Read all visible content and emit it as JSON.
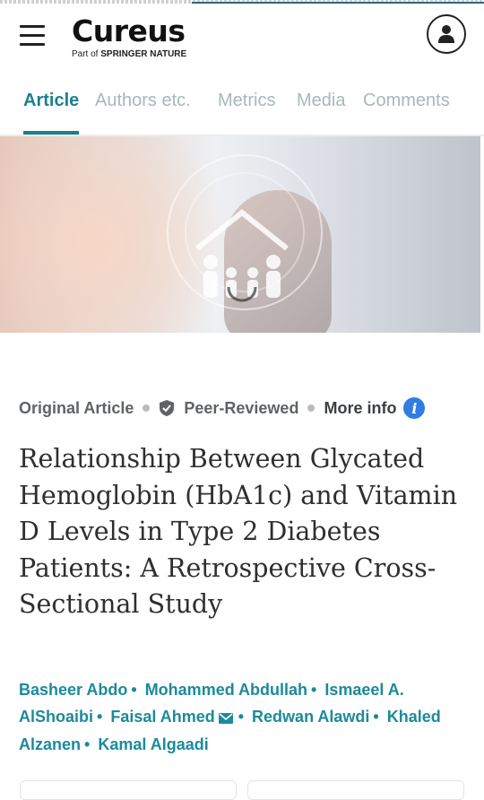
{
  "brand": {
    "logo_text": "Cureus",
    "sub_prefix": "Part of ",
    "sub_brand": "SPRINGER NATURE"
  },
  "tabs": [
    {
      "label": "Article",
      "active": true
    },
    {
      "label": "Authors etc.",
      "active": false
    },
    {
      "label": "Metrics",
      "active": false
    },
    {
      "label": "Media",
      "active": false
    },
    {
      "label": "Comments",
      "active": false
    }
  ],
  "meta": {
    "type": "Original Article",
    "peer": "Peer-Reviewed",
    "more": "More info"
  },
  "title": "Relationship Between Glycated Hemoglobin (HbA1c) and Vitamin D Levels in Type 2 Diabetes Patients: A Retrospective Cross-Sectional Study",
  "authors": [
    "Basheer Abdo",
    "Mohammed Abdullah",
    "Ismaeel A. AlShoaibi",
    "Faisal Ahmed",
    "Redwan Alawdi",
    "Khaled Alzanen",
    "Kamal Algaadi"
  ],
  "colors": {
    "accent": "#1c7f8f",
    "author_link": "#1c8a9b",
    "tab_inactive": "#a9b7ba",
    "info_blue": "#2f7de1"
  },
  "icons": {
    "menu": "hamburger-icon",
    "profile": "user-icon",
    "peer": "shield-check-icon",
    "info": "info-icon",
    "corresponding": "mail-icon"
  }
}
